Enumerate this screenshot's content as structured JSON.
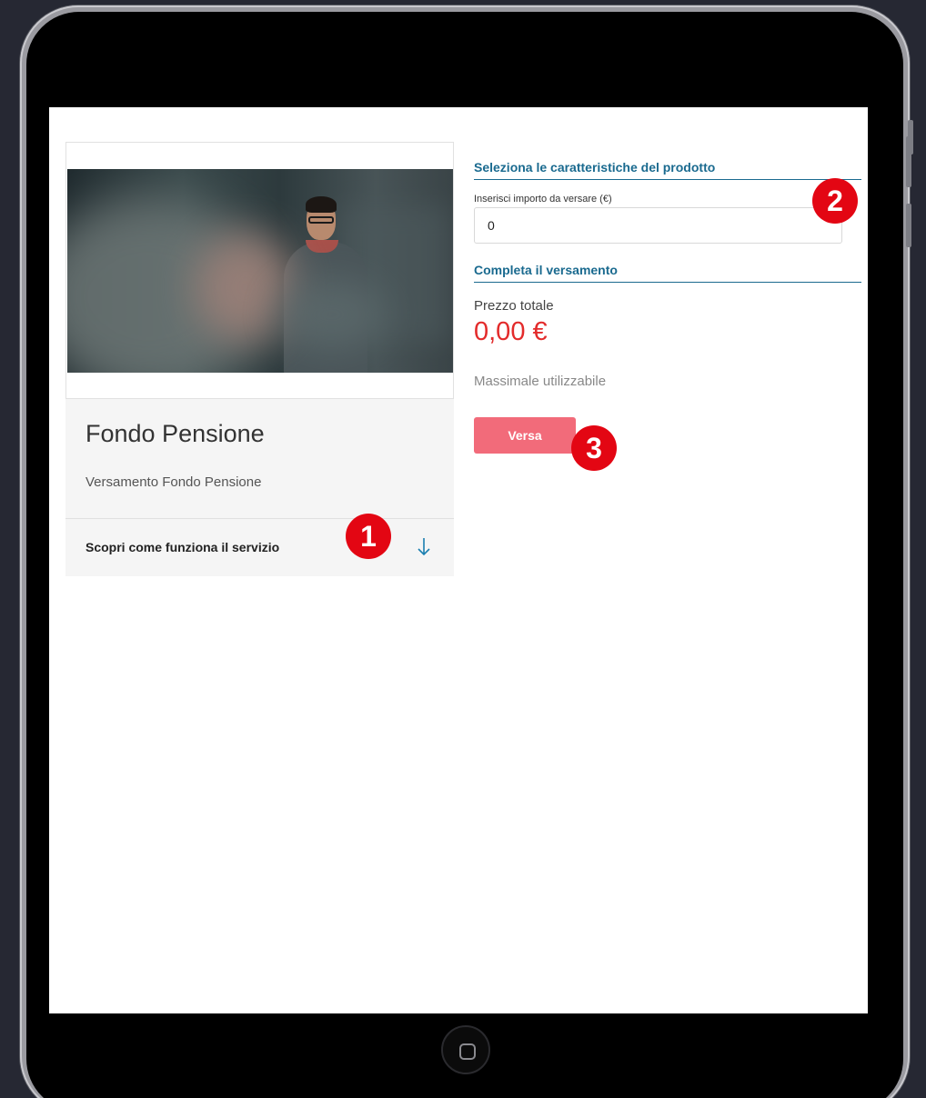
{
  "product": {
    "title": "Fondo Pensione",
    "subtitle": "Versamento Fondo Pensione",
    "discover_label": "Scopri come funziona il servizio"
  },
  "form": {
    "section_title": "Seleziona le caratteristiche del prodotto",
    "amount_label": "Inserisci importo da versare (€)",
    "amount_value": "0"
  },
  "payment": {
    "section_title": "Completa il versamento",
    "total_label": "Prezzo totale",
    "total_value": "0,00 €",
    "massimale_label": "Massimale utilizzabile",
    "submit_label": "Versa"
  },
  "annotations": [
    "1",
    "2",
    "3"
  ],
  "icons": {
    "expand": "arrow-down-icon",
    "home": "home-button-icon"
  },
  "colors": {
    "accent": "#1a6a8f",
    "price": "#e32b2b",
    "button": "#f26b7a",
    "badge": "#e30613"
  }
}
